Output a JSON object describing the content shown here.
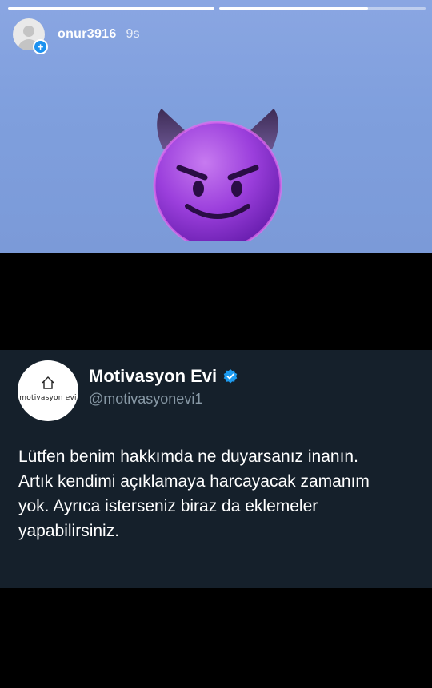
{
  "story": {
    "progress": [
      1.0,
      0.72
    ],
    "username": "onur3916",
    "time": "9s",
    "avatar_badge": "+"
  },
  "tweet": {
    "avatar_logo_text": "motivasyon evi",
    "name": "Motivasyon Evi",
    "handle": "@motivasyonevi1",
    "verified": true,
    "text": "Lütfen benim hakkımda ne duyarsanız inanın.\nArtık kendimi açıklamaya harcayacak zamanım\nyok. Ayrıca isterseniz biraz da eklemeler\nyapabilirsiniz."
  },
  "colors": {
    "top_panel": "#7f9fdd",
    "tweet_background": "#15202b",
    "handle": "#8899a6",
    "verified": "#1d9bf0",
    "devil_face": "#9b3fdc"
  },
  "icons": [
    "default-avatar-icon",
    "add-story-icon",
    "devil-emoji",
    "house-logo-icon",
    "verified-badge-icon"
  ]
}
